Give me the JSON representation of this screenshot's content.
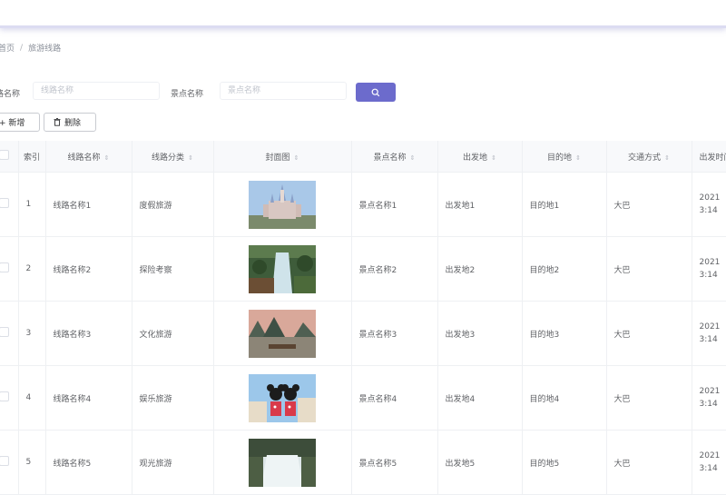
{
  "breadcrumb": {
    "parent": "首页",
    "separator": "/",
    "current": "旅游线路"
  },
  "search": {
    "route_label": "线路名称",
    "route_placeholder": "线路名称",
    "spot_label": "景点名称",
    "spot_placeholder": "景点名称"
  },
  "toolbar": {
    "add_label": "+ 新增",
    "delete_label": "删除"
  },
  "table": {
    "headers": [
      "索引",
      "线路名称",
      "线路分类",
      "封面图",
      "景点名称",
      "出发地",
      "目的地",
      "交通方式",
      "出发时间"
    ],
    "rows": [
      {
        "index": "1",
        "name": "线路名称1",
        "category": "度假旅游",
        "spot": "景点名称1",
        "from": "出发地1",
        "to": "目的地1",
        "transport": "大巴",
        "time1": "2021",
        "time2": "3:14",
        "cover": "castle"
      },
      {
        "index": "2",
        "name": "线路名称2",
        "category": "探险考察",
        "spot": "景点名称2",
        "from": "出发地2",
        "to": "目的地2",
        "transport": "大巴",
        "time1": "2021",
        "time2": "3:14",
        "cover": "waterfall"
      },
      {
        "index": "3",
        "name": "线路名称3",
        "category": "文化旅游",
        "spot": "景点名称3",
        "from": "出发地3",
        "to": "目的地3",
        "transport": "大巴",
        "time1": "2021",
        "time2": "3:14",
        "cover": "river"
      },
      {
        "index": "4",
        "name": "线路名称4",
        "category": "娱乐旅游",
        "spot": "景点名称4",
        "from": "出发地4",
        "to": "目的地4",
        "transport": "大巴",
        "time1": "2021",
        "time2": "3:14",
        "cover": "mickey"
      },
      {
        "index": "5",
        "name": "线路名称5",
        "category": "观光旅游",
        "spot": "景点名称5",
        "from": "出发地5",
        "to": "目的地5",
        "transport": "大巴",
        "time1": "2021",
        "time2": "3:14",
        "cover": "falls"
      }
    ]
  },
  "colors": {
    "primary": "#6c6bcc",
    "header_bg": "#f8f9fb",
    "border": "#eef0f3"
  }
}
